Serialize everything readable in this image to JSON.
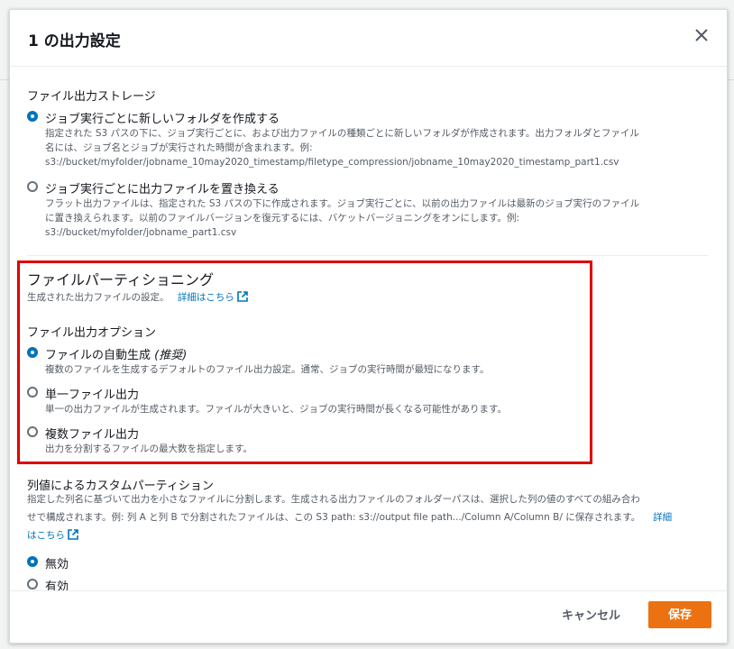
{
  "modal": {
    "title": "1 の出力設定",
    "storage": {
      "label": "ファイル出力ストレージ",
      "options": [
        {
          "title": "ジョブ実行ごとに新しいフォルダを作成する",
          "desc_lines": [
            "指定された S3 パスの下に、ジョブ実行ごとに、および出力ファイルの種類ごとに新しいフォルダが作成されます。出力フォルダとファイル",
            "名には、ジョブ名とジョブが実行された時間が含まれます。例:",
            "s3://bucket/myfolder/jobname_10may2020_timestamp/filetype_compression/jobname_10may2020_timestamp_part1.csv"
          ],
          "checked": true
        },
        {
          "title": "ジョブ実行ごとに出力ファイルを置き換える",
          "desc_lines": [
            "フラット出力ファイルは、指定された S3 パスの下に作成されます。ジョブ実行ごとに、以前の出力ファイルは最新のジョブ実行のファイル",
            "に置き換えられます。以前のファイルバージョンを復元するには、バケットバージョニングをオンにします。例:",
            "s3://bucket/myfolder/jobname_part1.csv"
          ],
          "checked": false
        }
      ]
    },
    "partitioning": {
      "heading": "ファイルパーティショニング",
      "subtitle": "生成された出力ファイルの設定。",
      "learn_more": "詳細はこちら",
      "options_label": "ファイル出力オプション",
      "options": [
        {
          "title": "ファイルの自動生成 ",
          "title_em": "(推奨)",
          "desc": "複数のファイルを生成するデフォルトのファイル出力設定。通常、ジョブの実行時間が最短になります。",
          "checked": true
        },
        {
          "title": "単一ファイル出力",
          "title_em": "",
          "desc": "単一の出力ファイルが生成されます。ファイルが大きいと、ジョブの実行時間が長くなる可能性があります。",
          "checked": false
        },
        {
          "title": "複数ファイル出力",
          "title_em": "",
          "desc": "出力を分割するファイルの最大数を指定します。",
          "checked": false
        }
      ]
    },
    "custom_partition": {
      "label": "列値によるカスタムパーティション",
      "line1": "指定した列名に基づいて出力を小さなファイルに分割します。生成される出力ファイルのフォルダーパスは、選択した列の値のすべての組み合わ",
      "line2": "せで構成されます。例: 列 A と列 B で分割されたファイルは、この S3 path: s3://output file path.../Column A/Column B/ に保存されます。",
      "link_part1": "詳細",
      "link_part2": "はこちら",
      "options": [
        {
          "title": "無効",
          "checked": true
        },
        {
          "title": "有効",
          "checked": false
        }
      ]
    },
    "footer": {
      "cancel_label": "キャンセル",
      "save_label": "保存"
    }
  },
  "colors": {
    "accent": "#0073bb",
    "primary_button": "#ec7211",
    "highlight_border": "#e00000"
  },
  "icons": [
    "close-icon",
    "external-link-icon"
  ]
}
